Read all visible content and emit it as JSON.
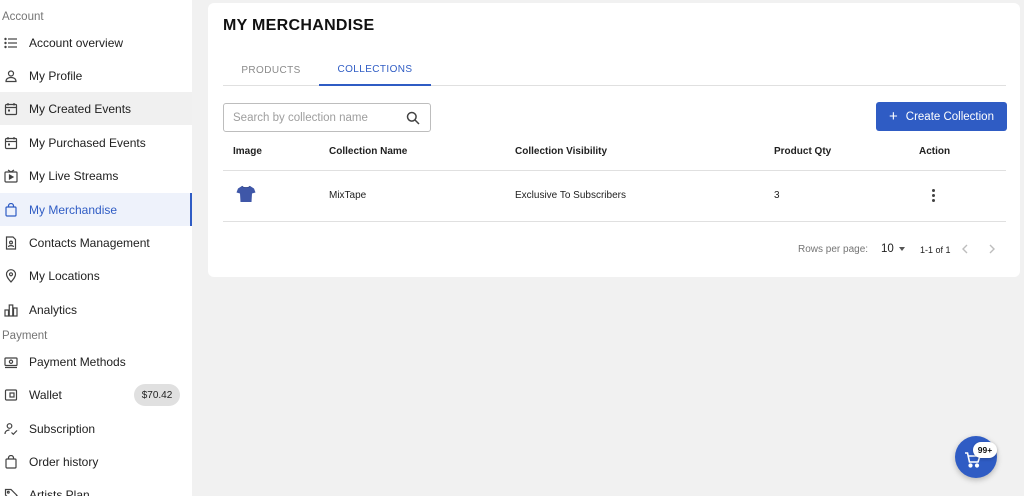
{
  "sidebar": {
    "sections": {
      "account": "Account",
      "payment": "Payment"
    },
    "items": [
      {
        "label": "Account overview",
        "icon": "list-icon"
      },
      {
        "label": "My Profile",
        "icon": "user-icon"
      },
      {
        "label": "My Created Events",
        "icon": "calendar-icon"
      },
      {
        "label": "My Purchased Events",
        "icon": "calendar-icon"
      },
      {
        "label": "My Live Streams",
        "icon": "live-stream-icon"
      },
      {
        "label": "My Merchandise",
        "icon": "shopping-bag-icon"
      },
      {
        "label": "Contacts Management",
        "icon": "contacts-icon"
      },
      {
        "label": "My Locations",
        "icon": "location-pin-icon"
      },
      {
        "label": "Analytics",
        "icon": "bar-chart-icon"
      },
      {
        "label": "Payment Methods",
        "icon": "payment-icon"
      },
      {
        "label": "Wallet",
        "icon": "wallet-icon"
      },
      {
        "label": "Subscription",
        "icon": "subscription-icon"
      },
      {
        "label": "Order history",
        "icon": "order-bag-icon"
      },
      {
        "label": "Artists Plan",
        "icon": "tag-icon"
      }
    ],
    "active_item": "My Merchandise",
    "wallet_balance": "$70.42"
  },
  "main": {
    "title": "MY MERCHANDISE",
    "tabs": [
      {
        "label": "PRODUCTS",
        "active": false
      },
      {
        "label": "COLLECTIONS",
        "active": true
      }
    ],
    "search": {
      "placeholder": "Search by collection name",
      "value": ""
    },
    "create_button": "Create Collection",
    "table": {
      "columns": [
        "Image",
        "Collection Name",
        "Collection Visibility",
        "Product Qty",
        "Action"
      ],
      "rows": [
        {
          "image": "tshirt-icon",
          "name": "MixTape",
          "visibility": "Exclusive To Subscribers",
          "qty": "3"
        }
      ]
    },
    "pagination": {
      "rows_per_page_label": "Rows per page:",
      "rows_per_page": "10",
      "range": "1-1 of 1"
    }
  },
  "cart": {
    "badge": "99+"
  },
  "colors": {
    "accent": "#2f5cc4",
    "background": "#f1f1f1",
    "card": "#ffffff"
  }
}
